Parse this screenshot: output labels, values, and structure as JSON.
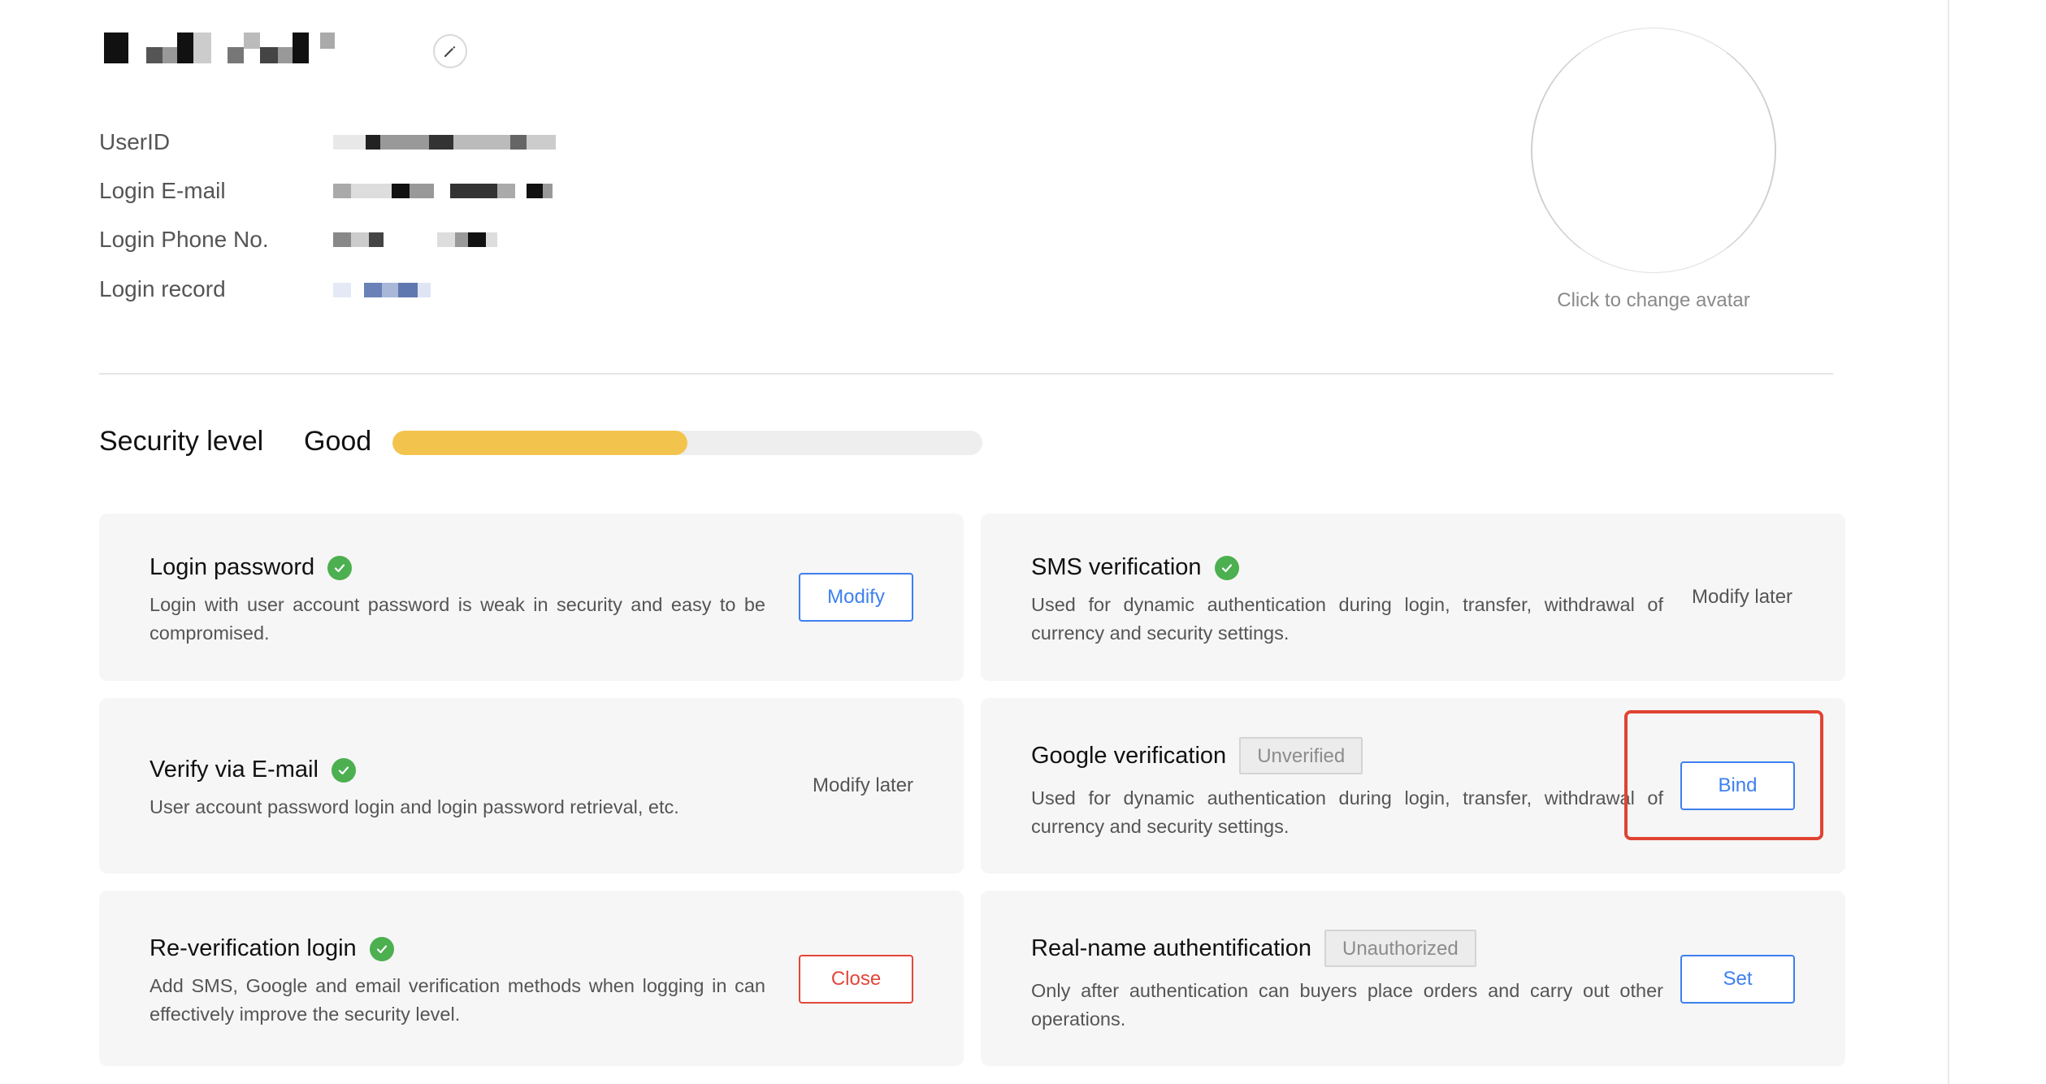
{
  "profile": {
    "fields": [
      {
        "label": "UserID"
      },
      {
        "label": "Login E-mail"
      },
      {
        "label": "Login Phone No."
      },
      {
        "label": "Login record"
      }
    ],
    "avatar_caption": "Click to change avatar",
    "edit_icon": "pencil-icon"
  },
  "security": {
    "title": "Security level",
    "level": "Good",
    "progress_fraction": 0.5,
    "colors": {
      "fill": "#f3c44d",
      "track": "#eeeeee"
    }
  },
  "cards": {
    "login_password": {
      "title": "Login password",
      "desc": "Login with user account password is weak in security and easy to be compromised.",
      "action": "Modify"
    },
    "sms": {
      "title": "SMS verification",
      "desc": "Used for dynamic authentication during login, transfer, withdrawal of currency and security settings.",
      "action": "Modify later"
    },
    "email": {
      "title": "Verify via E-mail",
      "desc": "User account password login and login password retrieval, etc.",
      "action": "Modify later"
    },
    "google": {
      "title": "Google verification",
      "tag": "Unverified",
      "desc": "Used for dynamic authentication during login, transfer, withdrawal of currency and security settings.",
      "action": "Bind"
    },
    "reverify": {
      "title": "Re-verification login",
      "desc": "Add SMS, Google and email verification methods when logging in can effectively improve the security level.",
      "action": "Close"
    },
    "realname": {
      "title": "Real-name authentification",
      "tag": "Unauthorized",
      "desc": "Only after authentication can buyers place orders and carry out other operations.",
      "action": "Set"
    }
  },
  "colors": {
    "primary": "#3d7ff0",
    "danger": "#e2463b",
    "success": "#4caf50",
    "highlight": "#e04333"
  }
}
